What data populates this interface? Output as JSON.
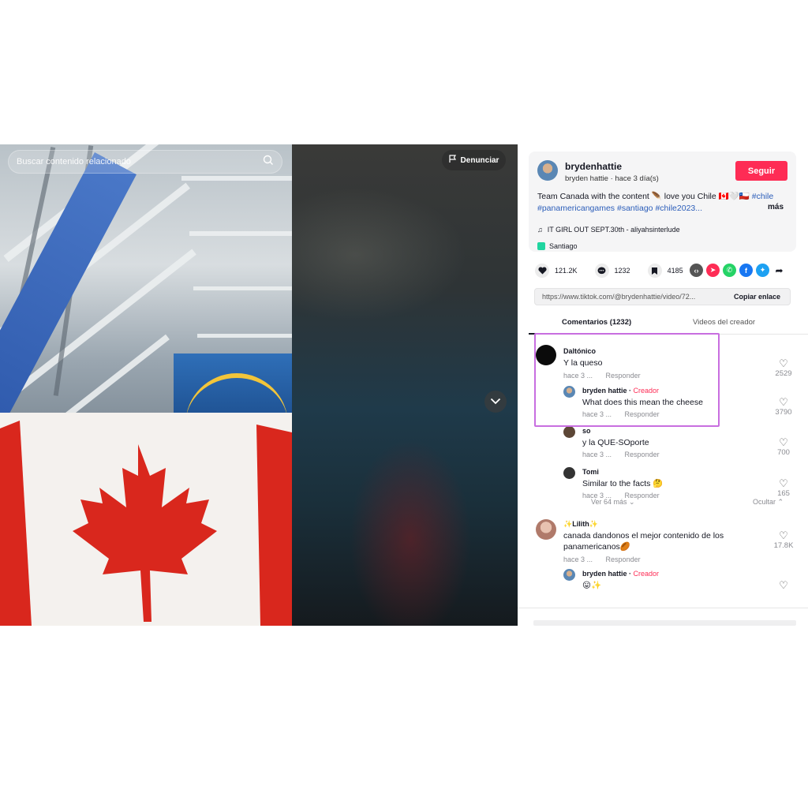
{
  "video": {
    "search_placeholder": "Buscar contenido relacionado",
    "report_label": "Denunciar"
  },
  "post": {
    "author_name": "brydenhattie",
    "author_sub": "bryden hattie · hace 3 día(s)",
    "follow_label": "Seguir",
    "desc_text": "Team Canada with the content 🪶 love you Chile 🇨🇦🤍🇨🇱",
    "desc_tags": [
      "#chile",
      "#panamericangames",
      "#santiago",
      "#chile2023..."
    ],
    "more_label": "más",
    "music": "IT GIRL OUT SEPT.30th - aliyahsinterlude",
    "location": "Santiago"
  },
  "stats": {
    "likes": "121.2K",
    "comments": "1232",
    "saves": "4185"
  },
  "share": {
    "link": "https://www.tiktok.com/@brydenhattie/video/72...",
    "copy_label": "Copiar enlace",
    "icons": [
      "embed-icon",
      "send-icon",
      "whatsapp-icon",
      "facebook-icon",
      "twitter-icon",
      "share-arrow-icon"
    ]
  },
  "tabs": {
    "comments": "Comentarios (1232)",
    "creator_videos": "Videos del creador"
  },
  "comments": [
    {
      "user": "Daltónico",
      "text": "Y la queso",
      "time": "hace 3 ...",
      "reply": "Responder",
      "likes": "2529",
      "replies": [
        {
          "user": "bryden hattie",
          "badge": "Creador",
          "text": "What does this mean the cheese",
          "time": "hace 3 ...",
          "reply": "Responder",
          "likes": "3790"
        },
        {
          "user": "so",
          "text": "y la QUE-SOporte",
          "time": "hace 3 ...",
          "reply": "Responder",
          "likes": "700"
        },
        {
          "user": "Tomi",
          "text": "Similar to the facts 🤔",
          "time": "hace 3 ...",
          "reply": "Responder",
          "likes": "165"
        }
      ],
      "view_more": "Ver 64 más",
      "hide": "Ocultar"
    },
    {
      "user": "✨Lilith✨",
      "text": "canada dandonos el mejor contenido de los panamericanos🏉",
      "time": "hace 3 ...",
      "reply": "Responder",
      "likes": "17.8K",
      "replies": [
        {
          "user": "bryden hattie",
          "badge": "Creador",
          "text": "😛✨"
        }
      ]
    }
  ],
  "colors": {
    "accent": "#fe2c55",
    "tag": "#2b5db9",
    "highlight": "#c86ee0"
  }
}
